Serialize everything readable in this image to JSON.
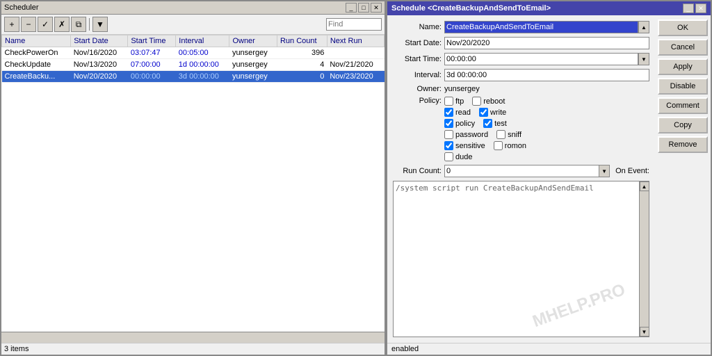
{
  "scheduler": {
    "title": "Scheduler",
    "toolbar": {
      "add_label": "+",
      "remove_label": "−",
      "check_label": "✓",
      "x_label": "✗",
      "copy_label": "⧉",
      "filter_label": "▼",
      "find_placeholder": "Find"
    },
    "table": {
      "columns": [
        "Name",
        "Start Date",
        "Start Time",
        "Interval",
        "Owner",
        "Run Count",
        "Next Run"
      ],
      "rows": [
        {
          "name": "CheckPowerOn",
          "start_date": "Nov/16/2020",
          "start_time": "03:07:47",
          "interval": "00:05:00",
          "owner": "yunsergey",
          "run_count": "396",
          "next_run": ""
        },
        {
          "name": "CheckUpdate",
          "start_date": "Nov/13/2020",
          "start_time": "07:00:00",
          "interval": "1d 00:00:00",
          "owner": "yunsergey",
          "run_count": "4",
          "next_run": "Nov/21/2020"
        },
        {
          "name": "CreateBacku...",
          "start_date": "Nov/20/2020",
          "start_time": "00:00:00",
          "interval": "3d 00:00:00",
          "owner": "yunsergey",
          "run_count": "0",
          "next_run": "Nov/23/2020"
        }
      ]
    },
    "status": "3 items"
  },
  "dialog": {
    "title": "Schedule <CreateBackupAndSendToEmail>",
    "fields": {
      "name_label": "Name:",
      "name_value": "CreateBackupAndSendToEmail",
      "start_date_label": "Start Date:",
      "start_date_value": "Nov/20/2020",
      "start_time_label": "Start Time:",
      "start_time_value": "00:00:00",
      "interval_label": "Interval:",
      "interval_value": "3d 00:00:00",
      "owner_label": "Owner:",
      "owner_value": "yunsergey",
      "policy_label": "Policy:"
    },
    "checkboxes": {
      "ftp": false,
      "reboot": false,
      "read": true,
      "write": true,
      "policy": true,
      "test": true,
      "password": false,
      "sniff": false,
      "sensitive": true,
      "romon": false,
      "dude": false
    },
    "run_count_label": "Run Count:",
    "run_count_value": "0",
    "on_event_label": "On Event:",
    "script_content": "/system script run CreateBackupAndSendEmail",
    "watermark": "MHELP.PRO",
    "buttons": {
      "ok": "OK",
      "cancel": "Cancel",
      "apply": "Apply",
      "disable": "Disable",
      "comment": "Comment",
      "copy": "Copy",
      "remove": "Remove"
    },
    "status": "enabled"
  }
}
